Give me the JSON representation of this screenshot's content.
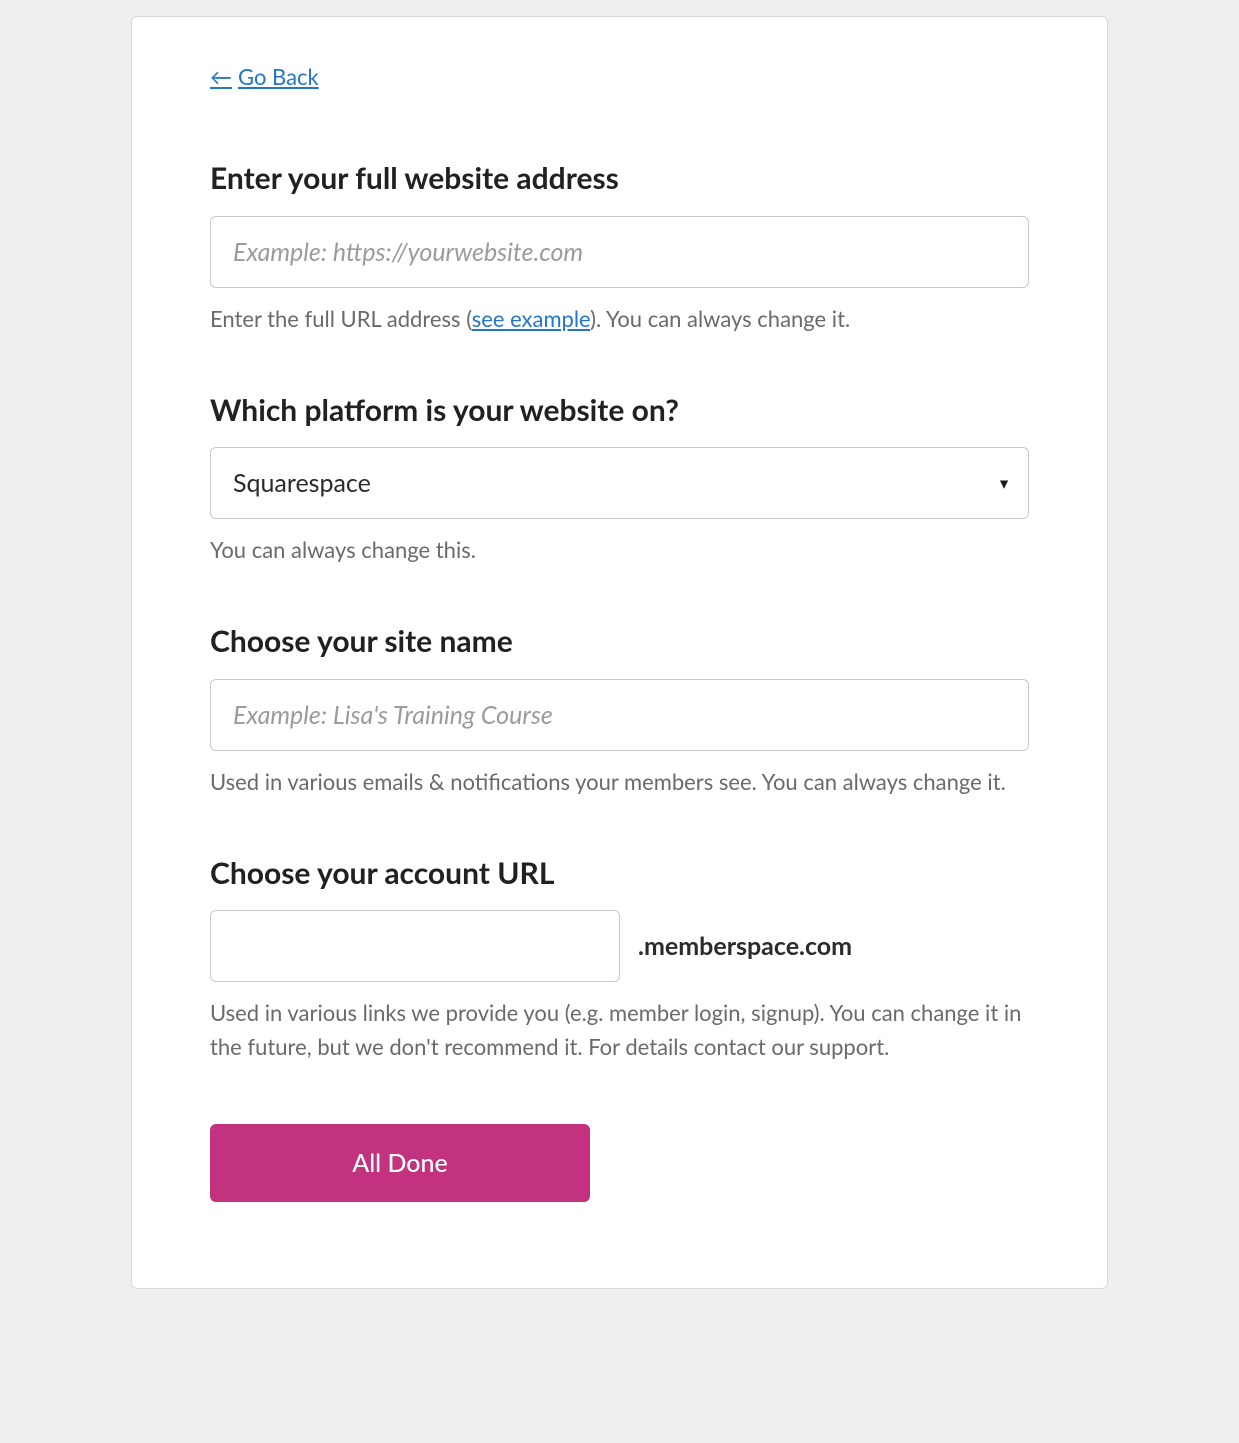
{
  "nav": {
    "go_back_label": "Go Back",
    "go_back_arrow": "←"
  },
  "website": {
    "heading": "Enter your full website address",
    "placeholder": "Example: https://yourwebsite.com",
    "value": "",
    "helper_before": "Enter the full URL address (",
    "helper_link": "see example",
    "helper_after": "). You can always change it."
  },
  "platform": {
    "heading": "Which platform is your website on?",
    "selected": "Squarespace",
    "helper": "You can always change this."
  },
  "site_name": {
    "heading": "Choose your site name",
    "placeholder": "Example: Lisa's Training Course",
    "value": "",
    "helper": "Used in various emails & notifications your members see. You can always change it."
  },
  "account_url": {
    "heading": "Choose your account URL",
    "value": "",
    "suffix": ".memberspace.com",
    "helper": "Used in various links we provide you (e.g. member login, signup). You can change it in the future, but we don't recommend it. For details contact our support."
  },
  "submit": {
    "label": "All Done"
  }
}
